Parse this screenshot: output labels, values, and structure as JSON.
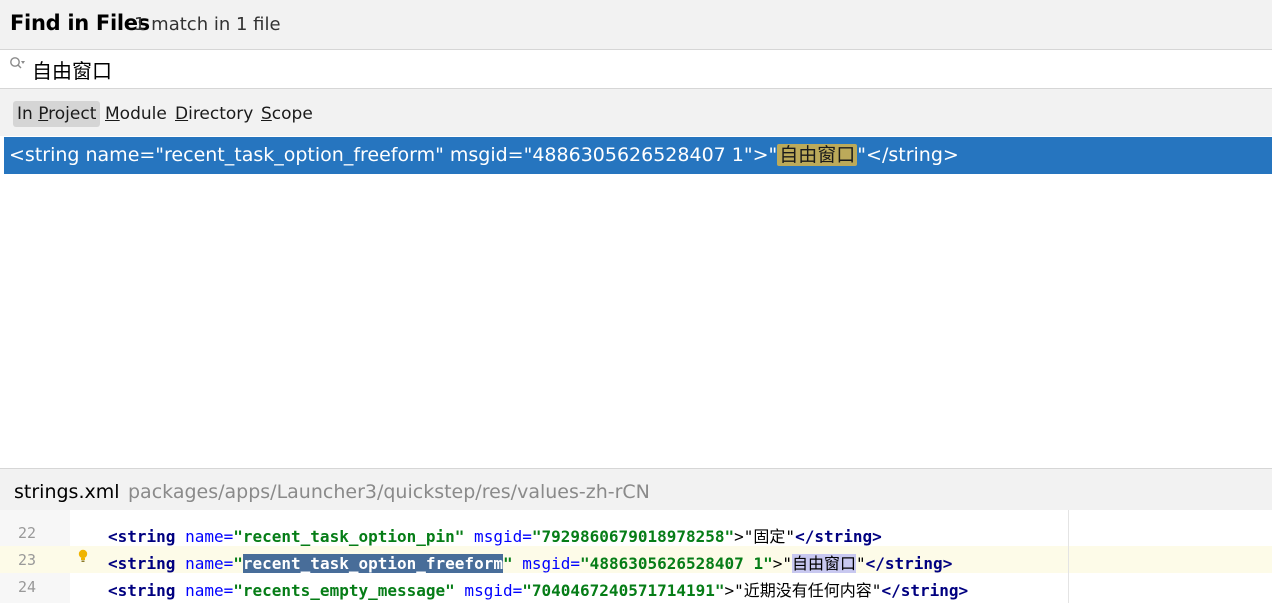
{
  "header": {
    "title": "Find in Files",
    "match_count": "1 match in 1 file"
  },
  "search": {
    "value": "自由窗口",
    "icon": "search-icon"
  },
  "scopes": [
    {
      "pre": "In ",
      "acc": "P",
      "post": "roject",
      "selected": true
    },
    {
      "pre": "",
      "acc": "M",
      "post": "odule",
      "selected": false
    },
    {
      "pre": "",
      "acc": "D",
      "post": "irectory",
      "selected": false
    },
    {
      "pre": "",
      "acc": "S",
      "post": "cope",
      "selected": false
    }
  ],
  "result": {
    "prefix": "<string name=\"recent_task_option_freeform\" msgid=\"4886305626528407 1\">\"",
    "match": "自由窗口",
    "suffix": "\"</string>"
  },
  "file": {
    "name": "strings.xml",
    "path": "packages/apps/Launcher3/quickstep/res/values-zh-rCN"
  },
  "preview": {
    "lines": [
      {
        "num": "22",
        "open": "<string",
        "attr1": " name=",
        "val1": "\"recent_task_option_pin\"",
        "attr2": " msgid=",
        "val2": "\"7929860679018978258\"",
        "text": ">\"固定\"",
        "close": "</string>"
      },
      {
        "num": "23",
        "open": "<string",
        "attr1": " name=",
        "val1_q1": "\"",
        "val1_sel": "recent_task_option_freeform",
        "val1_q2": "\"",
        "attr2": " msgid=",
        "val2": "\"4886305626528407 1\"",
        "text_pre": ">\"",
        "text_hit": "自由窗口",
        "text_post": "\"",
        "close": "</string>"
      },
      {
        "num": "24",
        "open": "<string",
        "attr1": " name=",
        "val1": "\"recents_empty_message\"",
        "attr2": " msgid=",
        "val2": "\"7040467240571714191\"",
        "text": ">\"近期没有任何内容\"",
        "close": "</string>"
      }
    ]
  },
  "colors": {
    "selection": "#2675bf",
    "match_highlight": "#bcaa5a",
    "tag": "#000080",
    "attribute": "#0000ff",
    "value": "#067d17"
  }
}
